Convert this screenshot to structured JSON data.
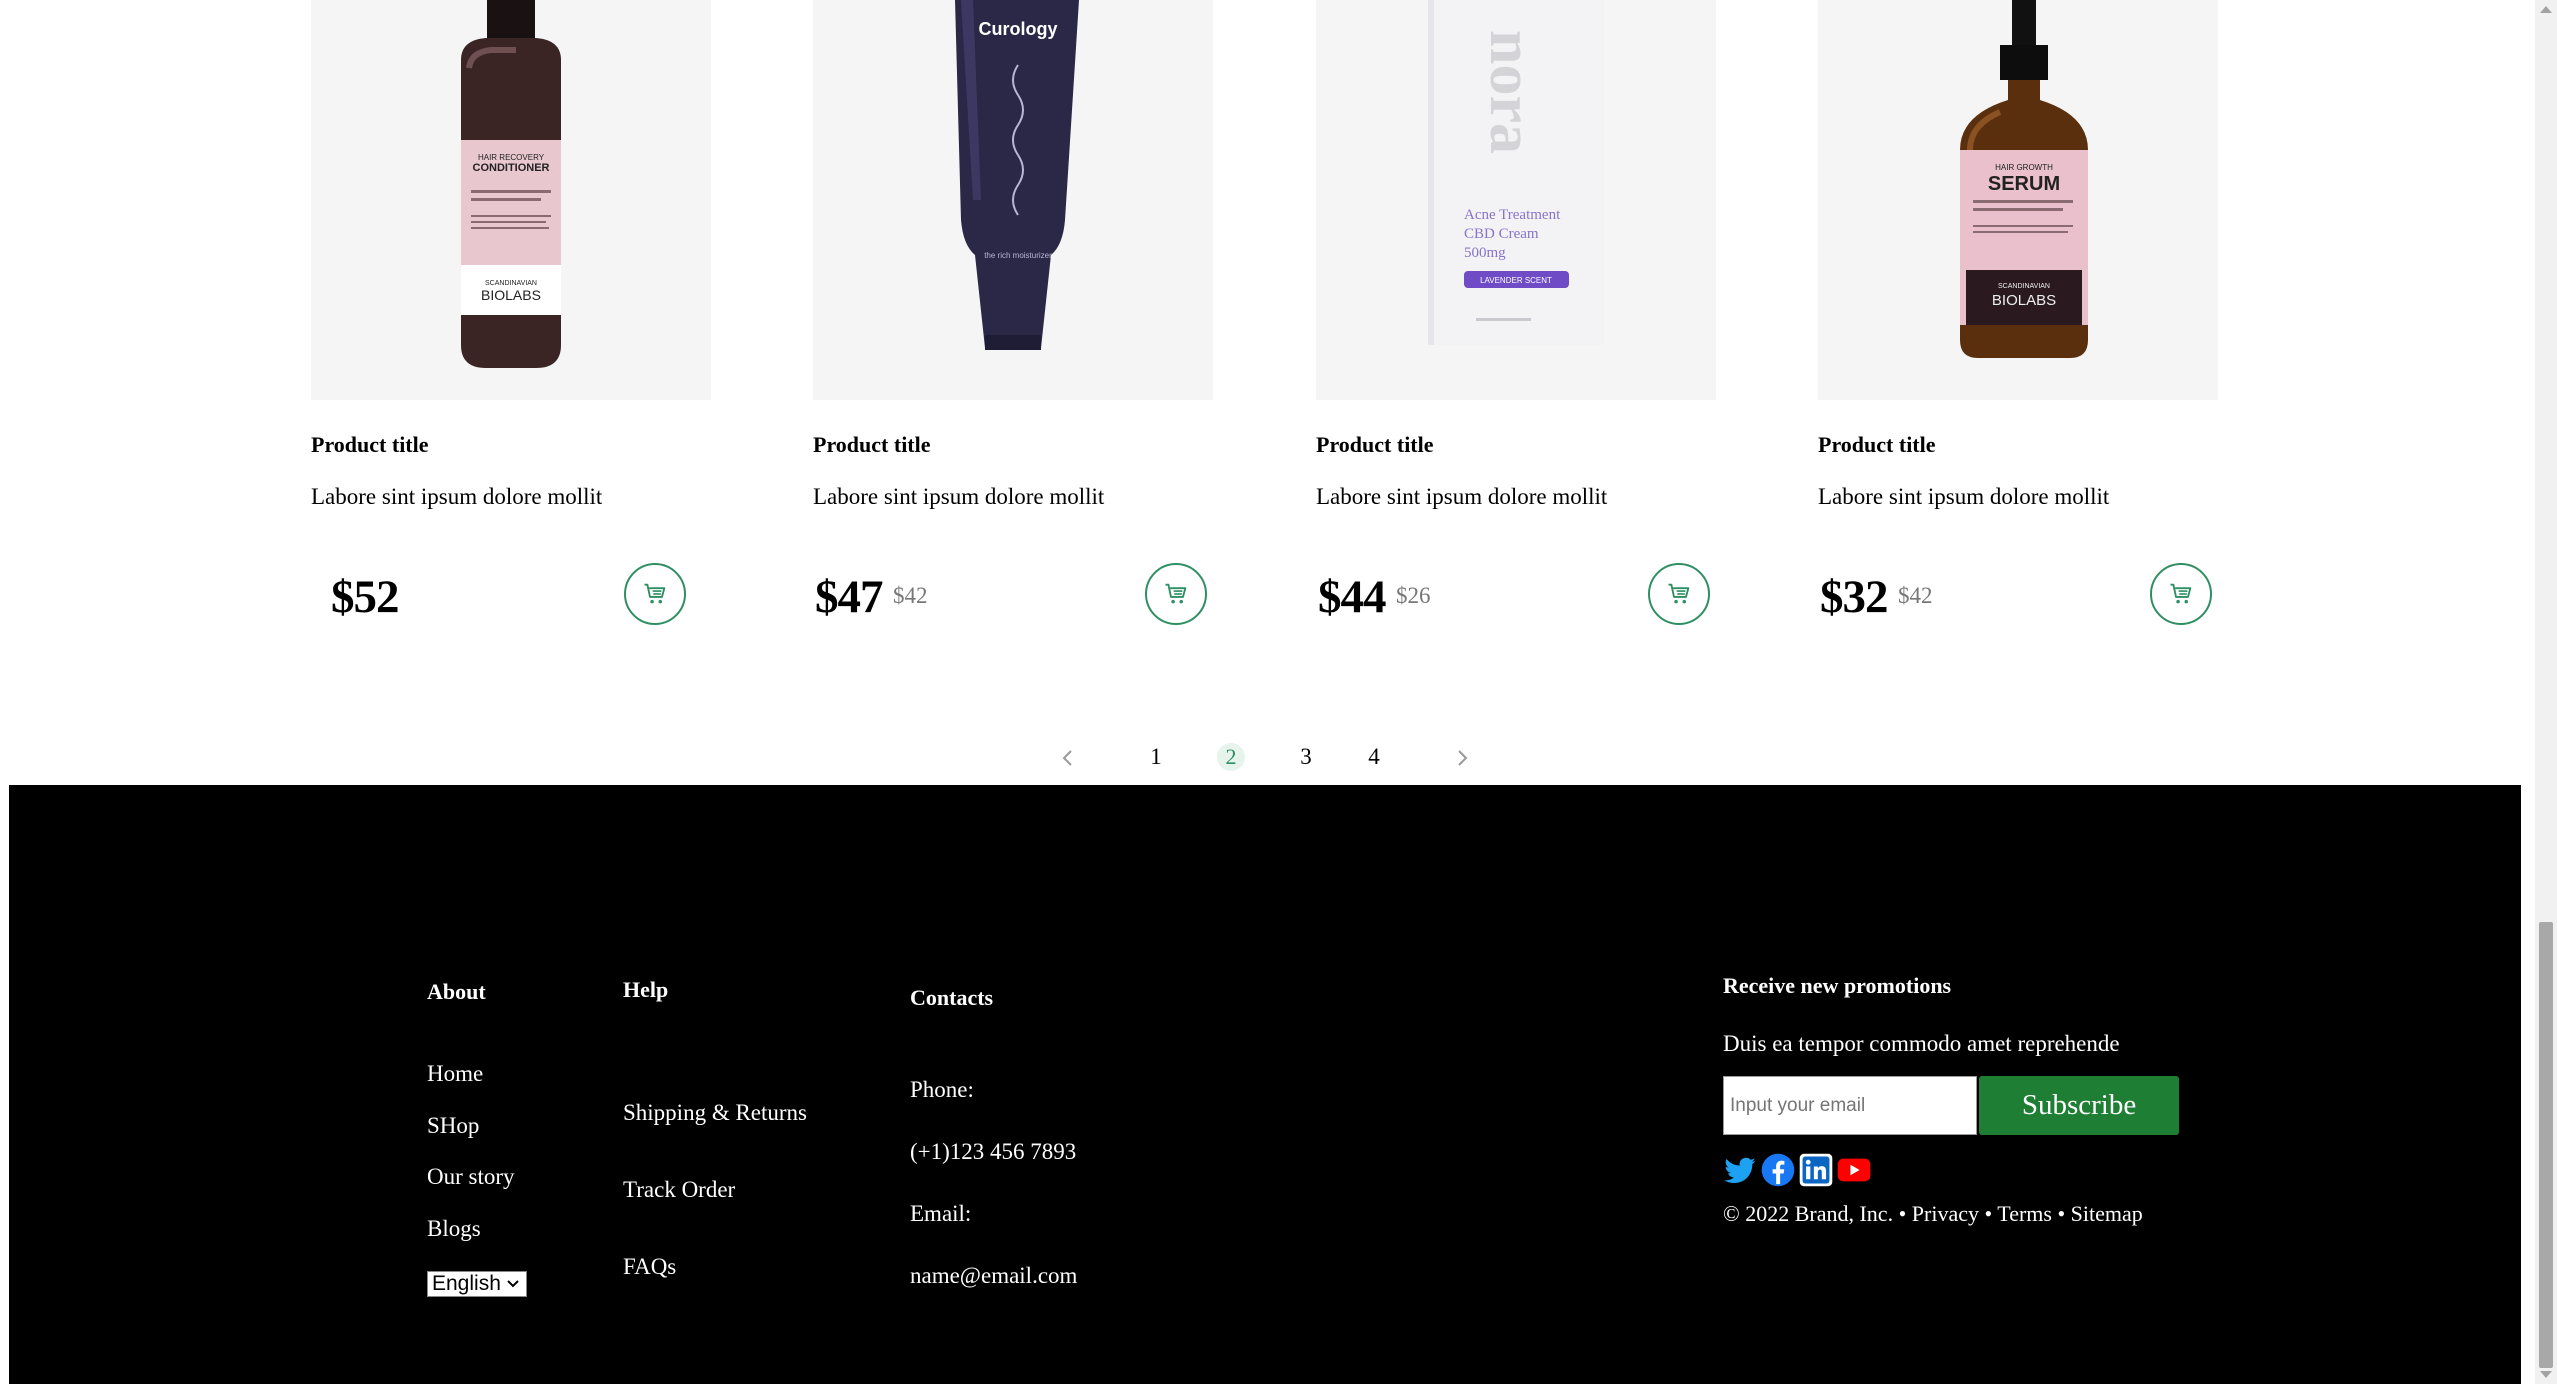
{
  "products": [
    {
      "title": "Product title",
      "description": "Labore sint ipsum dolore mollit",
      "price": "$52",
      "old_price": "",
      "image": "conditioner-bottle"
    },
    {
      "title": "Product title",
      "description": "Labore sint ipsum dolore mollit",
      "price": "$47",
      "old_price": "$42",
      "image": "curology-tube"
    },
    {
      "title": "Product title",
      "description": "Labore sint ipsum dolore mollit",
      "price": "$44",
      "old_price": "$26",
      "image": "nora-box"
    },
    {
      "title": "Product title",
      "description": "Labore sint ipsum dolore mollit",
      "price": "$32",
      "old_price": "$42",
      "image": "serum-bottle"
    }
  ],
  "product_images": {
    "conditioner": {
      "brand": "SCANDINAVIAN",
      "brand2": "BIOLABS",
      "line1": "HAIR RECOVERY",
      "line2": "CONDITIONER"
    },
    "curology": {
      "brand": "Curology",
      "small": "the rich moisturizer"
    },
    "nora": {
      "brand": "nora",
      "line1": "Acne Treatment",
      "line2": "CBD Cream",
      "line3": "500mg",
      "badge": "LAVENDER SCENT"
    },
    "serum": {
      "brand": "SCANDINAVIAN",
      "brand2": "BIOLABS",
      "line1": "HAIR GROWTH",
      "line2": "SERUM"
    }
  },
  "pagination": {
    "pages": [
      "1",
      "2",
      "3",
      "4"
    ],
    "current": "2"
  },
  "footer": {
    "about": {
      "heading": "About",
      "links": [
        "Home",
        "SHop",
        "Our story",
        "Blogs"
      ],
      "language": "English"
    },
    "help": {
      "heading": "Help",
      "links": [
        "Shipping & Returns",
        "Track Order",
        "FAQs"
      ]
    },
    "contacts": {
      "heading": "Contacts",
      "phone_label": "Phone:",
      "phone": "(+1)123 456 7893",
      "email_label": "Email:",
      "email": "name@email.com"
    },
    "promo": {
      "heading": "Receive new promotions",
      "text": "Duis ea tempor commodo amet reprehende",
      "email_placeholder": "Input your email",
      "subscribe_label": "Subscribe",
      "social": [
        "twitter-icon",
        "facebook-icon",
        "linkedin-icon",
        "youtube-icon"
      ]
    },
    "legal": {
      "copyright": "© 2022 Brand, Inc.",
      "sep": "•",
      "privacy": "Privacy",
      "terms": "Terms",
      "sitemap": "Sitemap"
    }
  },
  "colors": {
    "accent": "#2f8f63",
    "subscribe": "#1e7f34",
    "footer_bg": "#000000"
  }
}
